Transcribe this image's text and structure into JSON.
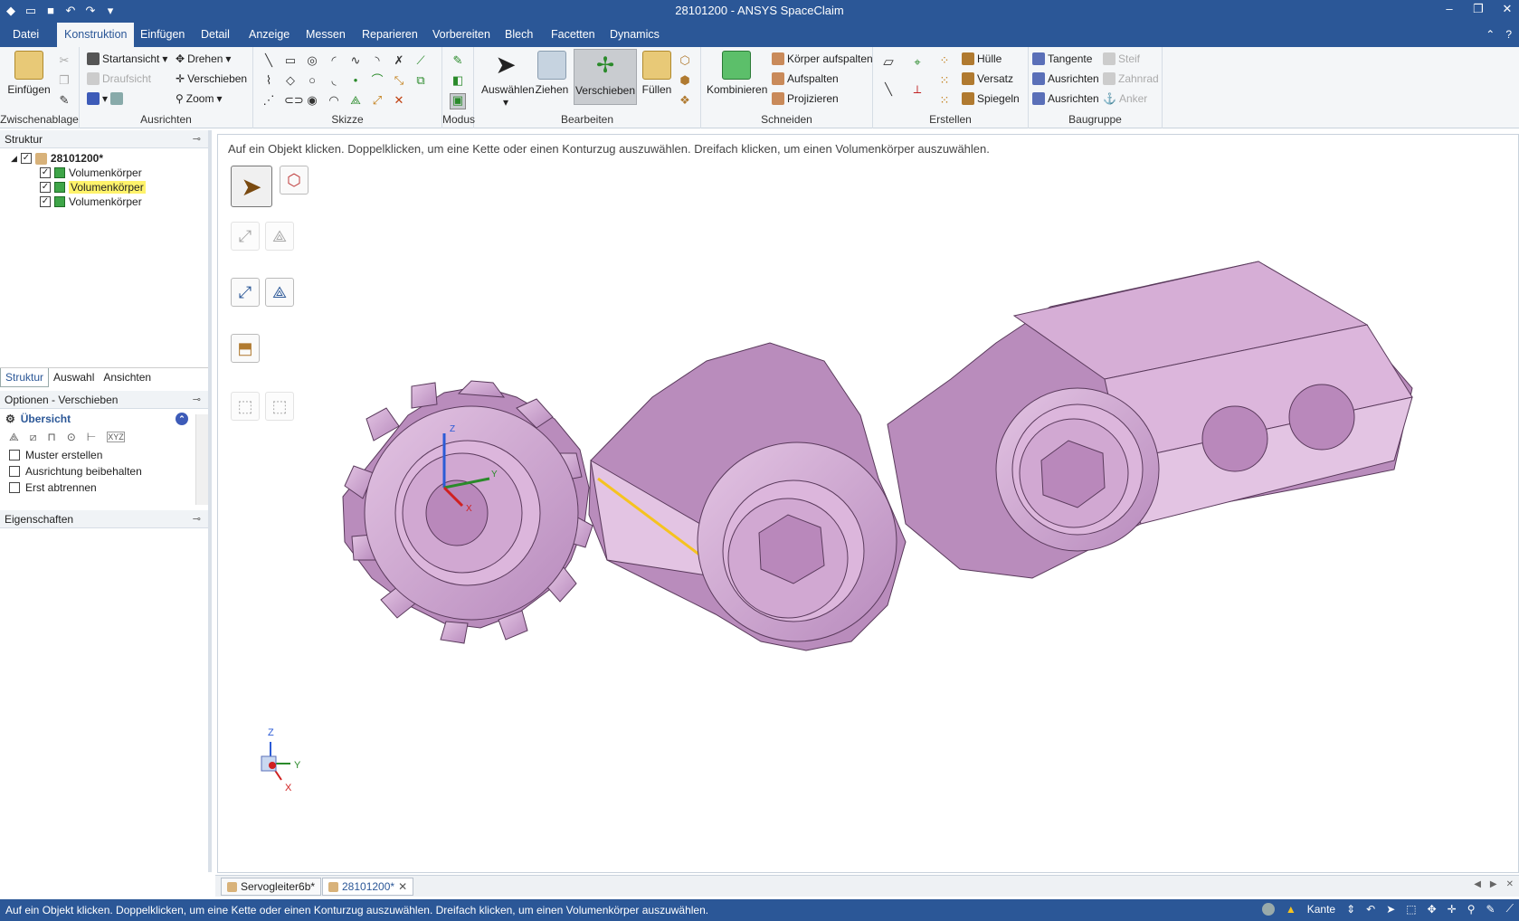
{
  "window": {
    "title": "28101200 - ANSYS SpaceClaim"
  },
  "menu": {
    "tabs": [
      "Datei",
      "Konstruktion",
      "Einfügen",
      "Detail",
      "Anzeige",
      "Messen",
      "Reparieren",
      "Vorbereiten",
      "Blech",
      "Facetten",
      "Dynamics"
    ],
    "active": "Konstruktion"
  },
  "ribbon": {
    "clipboard": {
      "paste": "Einfügen",
      "label": "Zwischenablage"
    },
    "orient": {
      "home": "Startansicht",
      "top": "Draufsicht",
      "spin": "Drehen",
      "pan": "Verschieben",
      "zoom": "Zoom",
      "label": "Ausrichten"
    },
    "sketch": {
      "label": "Skizze"
    },
    "mode": {
      "label": "Modus"
    },
    "edit": {
      "select": "Auswählen",
      "pull": "Ziehen",
      "move": "Verschieben",
      "fill": "Füllen",
      "label": "Bearbeiten"
    },
    "intersect": {
      "combine": "Kombinieren",
      "split_body": "Körper aufspalten",
      "split": "Aufspalten",
      "project": "Projizieren",
      "label": "Schneiden"
    },
    "create": {
      "shell": "Hülle",
      "offset": "Versatz",
      "mirror": "Spiegeln",
      "label": "Erstellen"
    },
    "assembly": {
      "tangent": "Tangente",
      "align1": "Ausrichten",
      "align2": "Ausrichten",
      "rigid": "Steif",
      "gear": "Zahnrad",
      "anchor": "Anker",
      "label": "Baugruppe"
    }
  },
  "structure": {
    "title": "Struktur",
    "root": "28101200*",
    "items": [
      "Volumenkörper",
      "Volumenkörper",
      "Volumenkörper"
    ],
    "tabs": [
      "Struktur",
      "Auswahl",
      "Ansichten"
    ]
  },
  "options": {
    "title": "Optionen - Verschieben",
    "section": "Übersicht",
    "checkboxes": [
      "Muster erstellen",
      "Ausrichtung beibehalten",
      "Erst abtrennen"
    ]
  },
  "properties": {
    "title": "Eigenschaften"
  },
  "canvas": {
    "hint": "Auf ein Objekt klicken.  Doppelklicken, um eine Kette oder einen Konturzug auszuwählen.  Dreifach klicken, um einen Volumenkörper auszuwählen.",
    "axis": {
      "z": "Z",
      "y": "Y",
      "x": "X"
    }
  },
  "doc_tabs": [
    "Servogleiter6b*",
    "28101200*"
  ],
  "status": {
    "message": "Auf ein Objekt klicken.  Doppelklicken, um eine Kette oder einen Konturzug auszuwählen.  Dreifach klicken, um einen Volumenkörper auszuwählen.",
    "filter": "Kante"
  },
  "colors": {
    "accent": "#2b5797",
    "part": "#d6aed6",
    "part_dark": "#a57aa8",
    "highlight": "#fff36b"
  }
}
